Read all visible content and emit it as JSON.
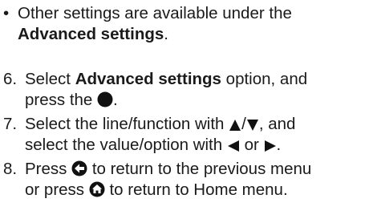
{
  "bullet": {
    "mark": "•",
    "text_before": "Other settings are available under the",
    "bold": "Advanced settings",
    "text_after": "."
  },
  "steps": [
    {
      "number": "6.",
      "text_before": "Select",
      "bold": "Advanced settings",
      "text_middle": "option, and press the",
      "icon": "circle-enter-icon",
      "text_after": "."
    },
    {
      "number": "7.",
      "text_before": "Select the line/function with",
      "icon1": "up-triangle-icon",
      "slash": "/",
      "icon2": "down-triangle-icon",
      "text_middle": ", and select the value/option with",
      "icon3": "left-triangle-icon",
      "or": "or",
      "icon4": "right-triangle-icon",
      "text_after": "."
    },
    {
      "number": "8.",
      "text_before": "Press",
      "icon1": "back-arrow-icon",
      "text_middle": "to return to the previous menu or press",
      "icon2": "home-icon",
      "text_after": "to return to Home menu."
    }
  ],
  "colors": {
    "text": "#1a1a1a",
    "icon": "#111111"
  }
}
